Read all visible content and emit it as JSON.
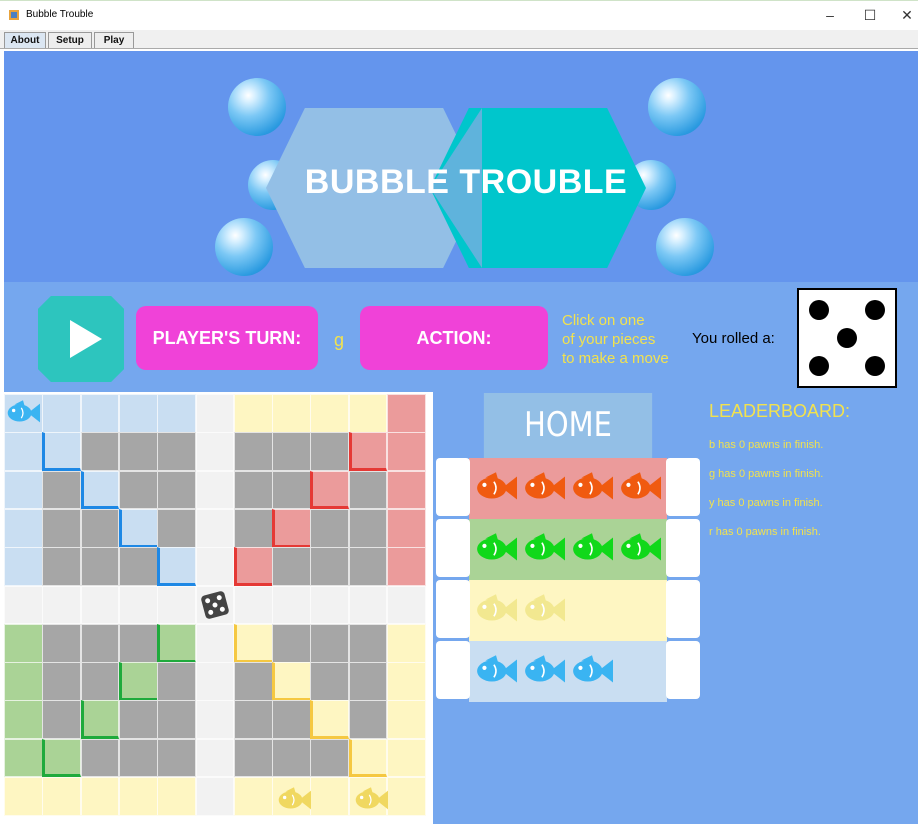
{
  "window": {
    "title": "Bubble Trouble",
    "controls": {
      "minimize": "–",
      "maximize": "☐",
      "close": "✕"
    }
  },
  "tabs": [
    {
      "label": "About",
      "active": true
    },
    {
      "label": "Setup",
      "active": false
    },
    {
      "label": "Play",
      "active": false
    }
  ],
  "banner": {
    "title": "BUBBLE TROUBLE"
  },
  "controls": {
    "turn_label": "PLAYER'S TURN:",
    "turn_value": "g",
    "action_label": "ACTION:",
    "hint_lines": [
      "Click on one",
      "of your pieces",
      "to make a move"
    ],
    "rolled_label": "You rolled a:",
    "die_value": 5
  },
  "home": {
    "title": "HOME",
    "rows": [
      {
        "color": "red",
        "fish_count": 4,
        "bg": "#eb9b9b",
        "fish_color": "#f05a10"
      },
      {
        "color": "green",
        "fish_count": 4,
        "bg": "#aad396",
        "fish_color": "#11d81a"
      },
      {
        "color": "yellow",
        "fish_count": 2,
        "bg": "#fef6c2",
        "fish_color": "#f2e890"
      },
      {
        "color": "blue",
        "fish_count": 3,
        "bg": "#c9def2",
        "fish_color": "#3ab4f2"
      }
    ]
  },
  "leaderboard": {
    "title": "LEADERBOARD:",
    "entries": [
      "b has 0 pawns in finish.",
      "g has 0 pawns in finish.",
      "y has 0 pawns in finish.",
      "r has 0 pawns in finish."
    ]
  },
  "colors": {
    "banner": "#6495ed",
    "panel": "#75a7ee",
    "accent_pink": "#f042d8",
    "accent_yellow": "#f2e24e",
    "teal": "#2dc5be"
  }
}
